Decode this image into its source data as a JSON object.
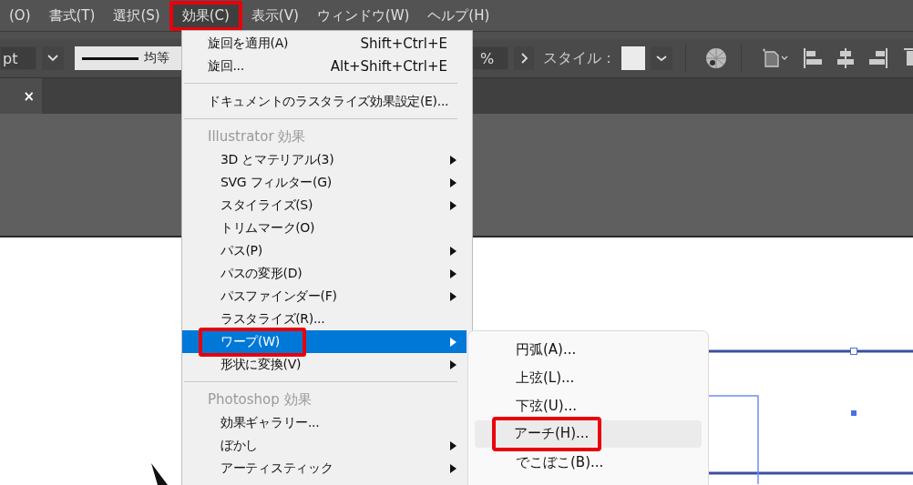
{
  "menu_bar": [
    {
      "label": "(O)",
      "selected": false,
      "highlighted": false
    },
    {
      "label": "書式(T)",
      "selected": false,
      "highlighted": false
    },
    {
      "label": "選択(S)",
      "selected": false,
      "highlighted": false
    },
    {
      "label": "効果(C)",
      "selected": true,
      "highlighted": true
    },
    {
      "label": "表示(V)",
      "selected": false,
      "highlighted": false
    },
    {
      "label": "ウィンドウ(W)",
      "selected": false,
      "highlighted": false
    },
    {
      "label": "ヘルプ(H)",
      "selected": false,
      "highlighted": false
    }
  ],
  "control_bar": {
    "stroke_unit": "pt",
    "profile_label": "均等",
    "opacity_unit": "%",
    "style_label": "スタイル："
  },
  "document_tab": {
    "close": "×"
  },
  "effect_menu": [
    {
      "items": [
        {
          "label": "旋回を適用(A)",
          "shortcut": "Shift+Ctrl+E",
          "submenu": false,
          "selected": false,
          "highlighted": false
        },
        {
          "label": "旋回...",
          "shortcut": "Alt+Shift+Ctrl+E",
          "submenu": false,
          "selected": false,
          "highlighted": false
        }
      ]
    },
    {
      "items": [
        {
          "label": "ドキュメントのラスタライズ効果設定(E)...",
          "submenu": false,
          "selected": false,
          "highlighted": false
        }
      ]
    },
    {
      "header": "Illustrator 効果",
      "items": [
        {
          "label": "3D とマテリアル(3)",
          "submenu": true,
          "selected": false,
          "highlighted": false
        },
        {
          "label": "SVG フィルター(G)",
          "submenu": true,
          "selected": false,
          "highlighted": false
        },
        {
          "label": "スタイライズ(S)",
          "submenu": true,
          "selected": false,
          "highlighted": false
        },
        {
          "label": "トリムマーク(O)",
          "submenu": false,
          "selected": false,
          "highlighted": false
        },
        {
          "label": "パス(P)",
          "submenu": true,
          "selected": false,
          "highlighted": false
        },
        {
          "label": "パスの変形(D)",
          "submenu": true,
          "selected": false,
          "highlighted": false
        },
        {
          "label": "パスファインダー(F)",
          "submenu": true,
          "selected": false,
          "highlighted": false
        },
        {
          "label": "ラスタライズ(R)...",
          "submenu": false,
          "selected": false,
          "highlighted": false
        },
        {
          "label": "ワープ(W)",
          "submenu": true,
          "selected": true,
          "highlighted": true
        },
        {
          "label": "形状に変換(V)",
          "submenu": true,
          "selected": false,
          "highlighted": false
        }
      ]
    },
    {
      "header": "Photoshop 効果",
      "items": [
        {
          "label": "効果ギャラリー...",
          "submenu": false,
          "selected": false,
          "highlighted": false
        },
        {
          "label": "ぼかし",
          "submenu": true,
          "selected": false,
          "highlighted": false
        },
        {
          "label": "アーティスティック",
          "submenu": true,
          "selected": false,
          "highlighted": false
        }
      ]
    }
  ],
  "warp_submenu": [
    {
      "label": "円弧(A)...",
      "selected": false,
      "highlighted": false
    },
    {
      "label": "上弦(L)...",
      "selected": false,
      "highlighted": false
    },
    {
      "label": "下弦(U)...",
      "selected": false,
      "highlighted": false
    },
    {
      "label": "アーチ(H)...",
      "selected": true,
      "highlighted": true
    },
    {
      "label": "でこぼこ(B)...",
      "selected": false,
      "highlighted": false
    }
  ]
}
